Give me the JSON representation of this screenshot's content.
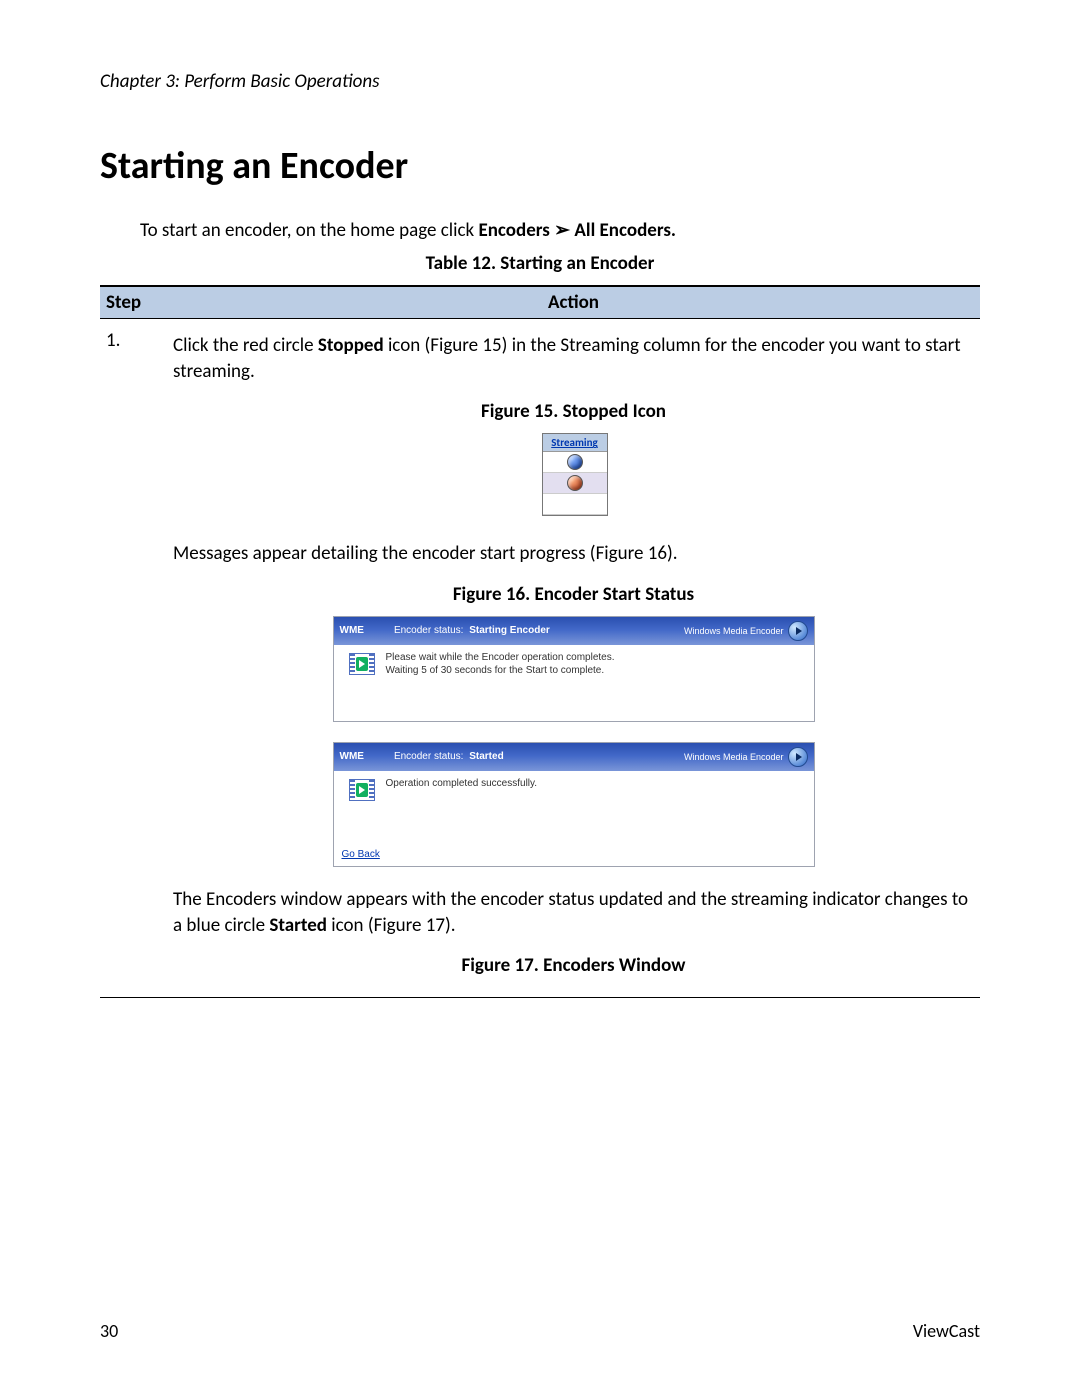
{
  "header": {
    "chapter": "Chapter 3: Perform Basic Operations"
  },
  "title": "Starting an Encoder",
  "intro": {
    "prefix": "To start an encoder, on the home page click ",
    "bold1": "Encoders",
    "arrow": " ➢ ",
    "bold2": "All Encoders."
  },
  "table": {
    "caption": "Table 12. Starting an Encoder",
    "head_step": "Step",
    "head_action": "Action",
    "row1_step": "1.",
    "row1_pre": "Click the red circle ",
    "row1_bold": "Stopped",
    "row1_post": " icon (Figure 15) in the Streaming column for the encoder you want to start streaming."
  },
  "fig15": {
    "caption": "Figure 15. Stopped Icon",
    "header": "Streaming"
  },
  "para_progress": "Messages appear detailing the encoder start progress (Figure 16).",
  "fig16": {
    "caption": "Figure 16. Encoder Start Status",
    "panel1": {
      "wme": "WME",
      "status_label": "Encoder status:",
      "status_value": "Starting Encoder",
      "right": "Windows Media Encoder",
      "msg_line1": "Please wait while the Encoder operation completes.",
      "msg_line2": "Waiting 5 of 30 seconds for the Start to complete."
    },
    "panel2": {
      "wme": "WME",
      "status_label": "Encoder status:",
      "status_value": "Started",
      "right": "Windows Media Encoder",
      "msg": "Operation completed successfully.",
      "goback": "Go Back"
    }
  },
  "para_after": {
    "pre": "The Encoders window appears with the encoder status updated and the streaming indicator changes to a blue circle ",
    "bold": "Started",
    "post": " icon (Figure 17)."
  },
  "fig17": {
    "caption": "Figure 17. Encoders Window"
  },
  "footer": {
    "page": "30",
    "brand": "ViewCast"
  }
}
